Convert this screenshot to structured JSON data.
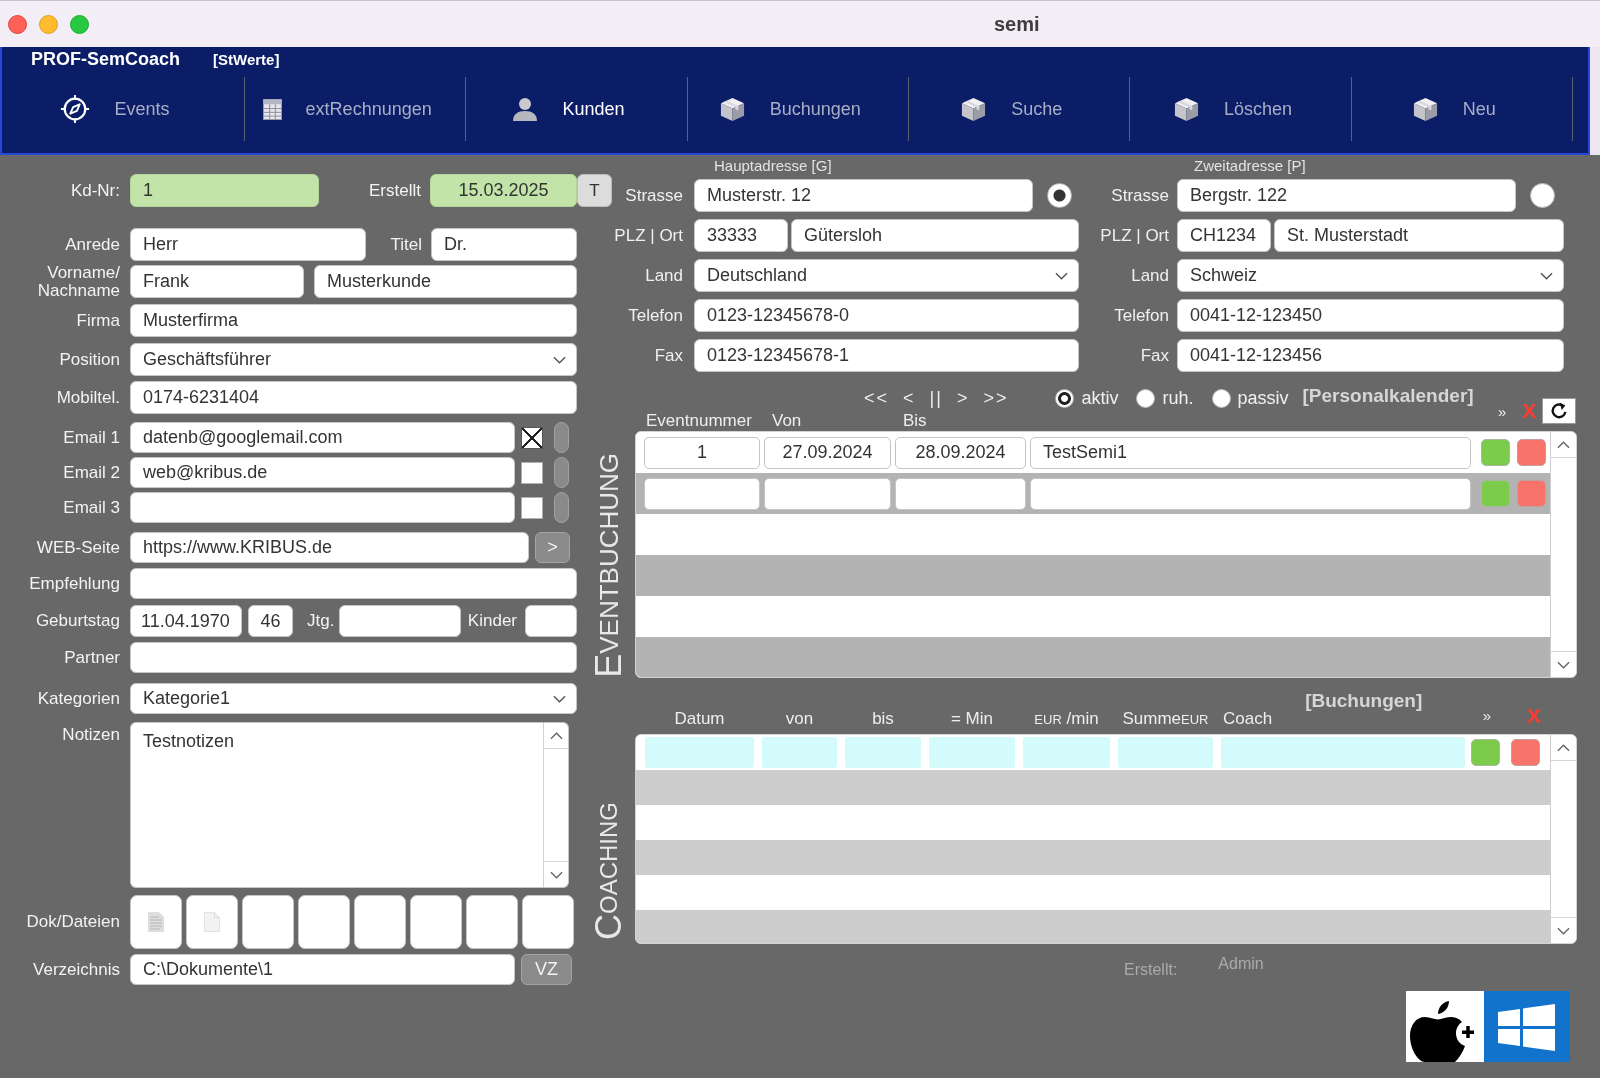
{
  "window": {
    "title": "semi"
  },
  "app": {
    "name": "PROF-SemCoach",
    "settings_link": "[StWerte]"
  },
  "tabs": [
    {
      "label": "Events",
      "selected": false
    },
    {
      "label": "extRechnungen",
      "selected": false
    },
    {
      "label": "Kunden",
      "selected": true
    },
    {
      "label": "Buchungen",
      "selected": false
    },
    {
      "label": "Suche",
      "selected": false
    },
    {
      "label": "Löschen",
      "selected": false
    },
    {
      "label": "Neu",
      "selected": false
    }
  ],
  "customer": {
    "kd_nr": {
      "label": "Kd-Nr:",
      "value": "1"
    },
    "erstellt": {
      "label": "Erstellt",
      "value": "15.03.2025",
      "button": "T"
    },
    "anrede": {
      "label": "Anrede",
      "value": "Herr"
    },
    "titel": {
      "label": "Titel",
      "value": "Dr."
    },
    "name": {
      "label": "Vorname/ Nachname",
      "vorname": "Frank",
      "nachname": "Musterkunde"
    },
    "firma": {
      "label": "Firma",
      "value": "Musterfirma"
    },
    "position": {
      "label": "Position",
      "value": "Geschäftsführer"
    },
    "mobiltel": {
      "label": "Mobiltel.",
      "value": "0174-6231404"
    },
    "emails": [
      {
        "label": "Email 1",
        "value": "datenb@googlemail.com",
        "checked": true
      },
      {
        "label": "Email 2",
        "value": "web@kribus.de",
        "checked": false
      },
      {
        "label": "Email 3",
        "checked": false
      }
    ],
    "web": {
      "label": "WEB-Seite",
      "value": "https://www.KRIBUS.de",
      "button": ">"
    },
    "empfehlung": {
      "label": "Empfehlung"
    },
    "geburtstag": {
      "label": "Geburtstag",
      "value": "11.04.1970",
      "alter": "46",
      "jtg_label": "Jtg.",
      "kinder_label": "Kinder"
    },
    "partner": {
      "label": "Partner"
    },
    "kategorien": {
      "label": "Kategorien",
      "value": "Kategorie1"
    },
    "notizen": {
      "label": "Notizen",
      "value": "Testnotizen"
    },
    "dokumente": {
      "label": "Dok/Dateien",
      "slots": [
        {
          "kind": "text-file"
        },
        {
          "kind": "blank-file"
        },
        {
          "kind": "empty"
        },
        {
          "kind": "empty"
        },
        {
          "kind": "empty"
        },
        {
          "kind": "empty"
        },
        {
          "kind": "empty"
        },
        {
          "kind": "empty"
        }
      ]
    },
    "verzeichnis": {
      "label": "Verzeichnis",
      "value": "C:\\Dokumente\\1",
      "button": "VZ"
    }
  },
  "addresses": [
    {
      "heading": "Hauptadresse [G]",
      "selected": true,
      "street_label": "Strasse",
      "street": "Musterstr. 12",
      "city_label": "PLZ | Ort",
      "zip": "33333",
      "city": "Gütersloh",
      "country_label": "Land",
      "country": "Deutschland",
      "phone_label": "Telefon",
      "phone": "0123-12345678-0",
      "fax_label": "Fax",
      "fax": "0123-12345678-1"
    },
    {
      "heading": "Zweitadresse [P]",
      "selected": false,
      "street_label": "Strasse",
      "street": "Bergstr. 122",
      "city_label": "PLZ | Ort",
      "zip": "CH1234",
      "city": "St. Musterstadt",
      "country_label": "Land",
      "country": "Schweiz",
      "phone_label": "Telefon",
      "phone": "0041-12-123450",
      "fax_label": "Fax",
      "fax": "0041-12-123456"
    }
  ],
  "events": {
    "section_title": "EVENTBUCHUNG",
    "pager": [
      "<<",
      "<",
      "||",
      ">",
      ">>"
    ],
    "filters": [
      {
        "label": "aktiv",
        "selected": true
      },
      {
        "label": "ruh.",
        "selected": false
      },
      {
        "label": "passiv",
        "selected": false
      }
    ],
    "calendar_link": "[Personalkalender]",
    "expand": "»",
    "delete": "X",
    "columns": [
      "Eventnummer",
      "Von",
      "Bis"
    ],
    "rows": [
      {
        "kind": "entry",
        "number": "1",
        "from": "27.09.2024",
        "to": "28.09.2024",
        "title": "TestSemi1"
      },
      {
        "kind": "blank"
      }
    ]
  },
  "coaching": {
    "section_title": "COACHING",
    "bookings_link": "[Buchungen]",
    "expand": "»",
    "delete": "X",
    "columns": [
      {
        "label": "Datum"
      },
      {
        "label": "von"
      },
      {
        "label": "bis"
      },
      {
        "label": "= Min"
      },
      {
        "label": "/min",
        "prefix": "EUR"
      },
      {
        "label": "Summe",
        "suffix": "EUR"
      },
      {
        "label": "Coach"
      }
    ],
    "rows": [
      {
        "kind": "input"
      }
    ]
  },
  "footer": {
    "created_label": "Erstellt:",
    "created_by": "Admin"
  }
}
